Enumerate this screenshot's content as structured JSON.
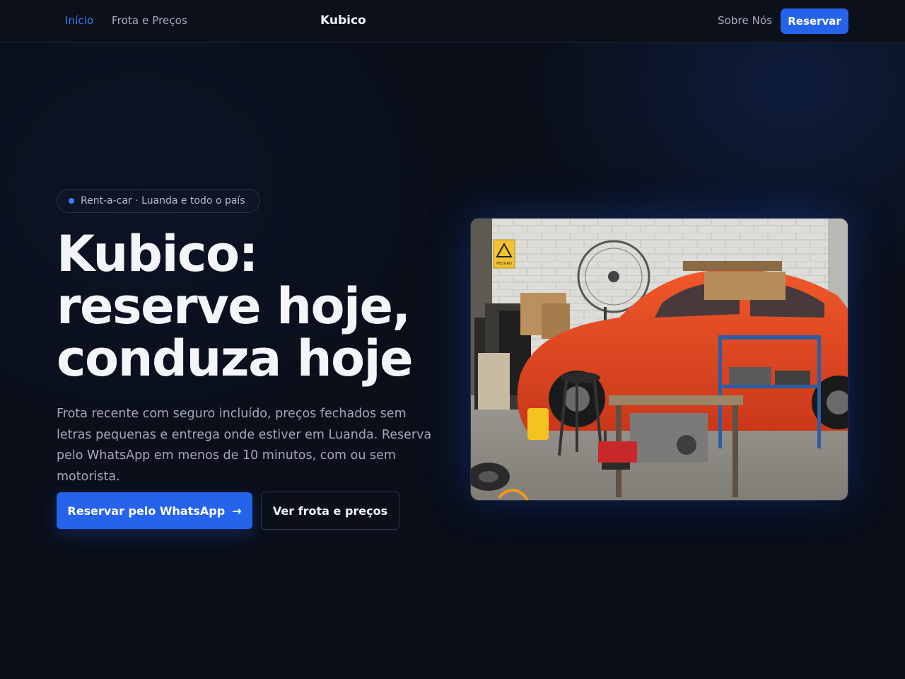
{
  "nav": {
    "links_left": [
      "Início",
      "Frota e Preços"
    ],
    "brand": "Kubico",
    "link_right": "Sobre Nós",
    "cta": "Reservar"
  },
  "hero": {
    "badge": "Rent-a-car · Luanda e todo o país",
    "headline": "Kubico: reserve hoje, conduza hoje",
    "lead": "Frota recente com seguro incluído, preços fechados sem letras pequenas e entrega onde estiver em Luanda. Reserva pelo WhatsApp em menos de 10 minutos, com ou sem motorista.",
    "primary_cta": "Reservar pelo WhatsApp",
    "primary_cta_icon": "arrow-right-icon",
    "secondary_cta": "Ver frota e preços",
    "image_sign": "PELIGRO"
  },
  "colors": {
    "background": "#0a0f1a",
    "accent": "#2563eb",
    "active_link": "#3b7cf6",
    "text": "#f4f5f8",
    "muted": "#a1a8b6"
  }
}
